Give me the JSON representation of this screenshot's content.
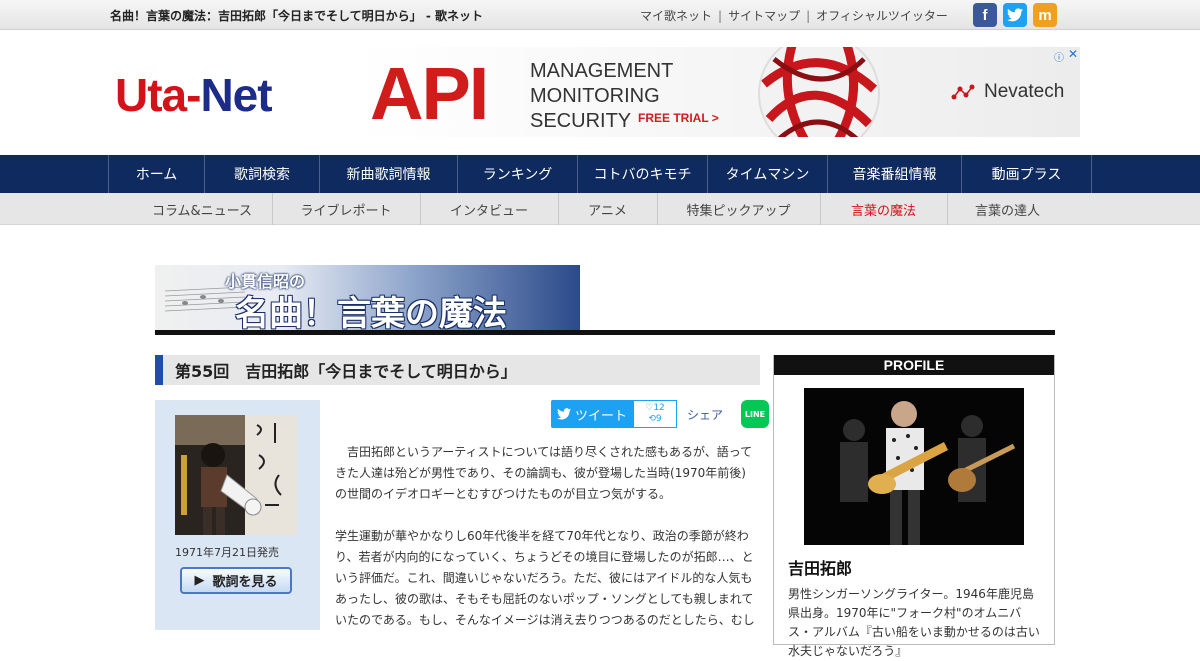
{
  "topbar": {
    "site_title": "名曲！言葉の魔法：吉田拓郎「今日までそして明日から」 - 歌ネット",
    "links": [
      "マイ歌ネット",
      "サイトマップ",
      "オフィシャルツイッター"
    ],
    "social": {
      "facebook": "f",
      "twitter": "t",
      "mixi": "m"
    }
  },
  "logo": {
    "part1": "Uta-",
    "part2": "Net"
  },
  "ad": {
    "headline": "API",
    "line1": "MANAGEMENT",
    "line2": "MONITORING",
    "line3": "SECURITY",
    "cta": "FREE TRIAL >",
    "brand": "Nevatech",
    "info": "ⓘ",
    "close": "✕"
  },
  "mainnav": [
    "ホーム",
    "歌詞検索",
    "新曲歌詞情報",
    "ランキング",
    "コトバのキモチ",
    "タイムマシン",
    "音楽番組情報",
    "動画プラス"
  ],
  "subnav": [
    "コラム&ニュース",
    "ライブレポート",
    "インタビュー",
    "アニメ",
    "特集ピックアップ",
    "言葉の魔法",
    "言葉の達人"
  ],
  "banner": {
    "sub": "小貫信昭の",
    "main": "名曲！言葉の魔法"
  },
  "article": {
    "title": "第55回　吉田拓郎「今日までそして明日から」",
    "release_date": "1971年7月21日発売",
    "lyrics_button": "歌詞を見る",
    "tweet_label": "ツイート",
    "like_count": "12",
    "retweet_count": "9",
    "share_label": "シェア",
    "line_label": "LINE",
    "paragraphs": [
      "　吉田拓郎というアーティストについては語り尽くされた感もあるが、語ってきた人達は殆どが男性であり、その論調も、彼が登場した当時(1970年前後)の世間のイデオロギーとむすびつけたものが目立つ気がする。",
      "学生運動が華やかなりし60年代後半を経て70年代となり、政治の季節が終わり、若者が内向的になっていく、ちょうどその境目に登場したのが拓郎…、という評価だ。これ、間違いじゃないだろう。ただ、彼にはアイドル的な人気もあったし、彼の歌は、そもそも屈託のないポップ・ソングとしても親しまれていたのである。もし、そんなイメージは消え去りつつあるのだとしたら、むし"
    ]
  },
  "profile": {
    "header": "PROFILE",
    "name": "吉田拓郎",
    "description": "男性シンガーソングライター。1946年鹿児島県出身。1970年に\"フォーク村\"のオムニバス・アルバム『古い船をいま動かせるのは古い水夫じゃないだろう』"
  },
  "colors": {
    "nav_bg": "#0e2a5f",
    "accent_red": "#d4121a",
    "title_bar": "#1e4fa8"
  }
}
